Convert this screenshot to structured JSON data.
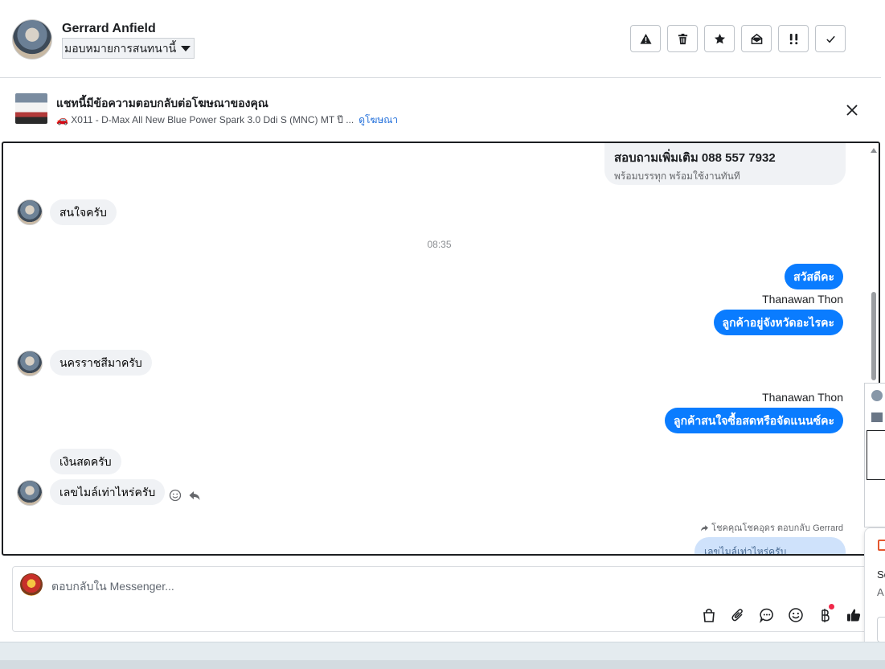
{
  "header": {
    "contact_name": "Gerrard Anfield",
    "assign_label": "มอบหมายการสนทนานี้",
    "actions": [
      {
        "name": "report-spam",
        "icon": "warning-icon"
      },
      {
        "name": "delete",
        "icon": "trash-icon"
      },
      {
        "name": "star",
        "icon": "star-icon"
      },
      {
        "name": "mark-unread",
        "icon": "envelope-open-icon"
      },
      {
        "name": "follow-up",
        "icon": "exclamation-icon"
      },
      {
        "name": "mark-done",
        "icon": "check-icon"
      }
    ]
  },
  "ad_banner": {
    "title": "แชทนี้มีข้อความตอบกลับต่อโฆษณาของคุณ",
    "subtitle": "🚗 X011 - D-Max All New Blue Power Spark 3.0 Ddi S (MNC) MT ปี ...",
    "link": "ดูโฆษณา"
  },
  "chat": {
    "ad_card": {
      "title": "สอบถามเพิ่มเติม 088 557 7932",
      "subtitle": "พร้อมบรรทุก พร้อมใช้งานทันที"
    },
    "messages": {
      "m1": "สนใจครับ",
      "time1": "08:35",
      "m2": "สวัสดีคะ",
      "sender1": "Thanawan Thon",
      "m3": "ลูกค้าอยู่จังหวัดอะไรคะ",
      "m4": "นครราชสีมาครับ",
      "sender2": "Thanawan Thon",
      "m5": "ลูกค้าสนใจซื้อสดหรือจัดแนนซ์คะ",
      "m6": "เงินสดครับ",
      "m7": "เลขไมล์เท่าไหร่ครับ",
      "reply_meta": "โชคคุณโชคอุดร ตอบกลับ Gerrard",
      "reply_quote": "เลขไมล์เท่าไหร่ครับ"
    }
  },
  "composer": {
    "placeholder": "ตอบกลับใน Messenger...",
    "tools": [
      "shopping-bag-icon",
      "paperclip-icon",
      "chat-bubble-icon",
      "emoji-icon",
      "baht-icon",
      "thumbs-up-icon"
    ]
  },
  "side_card": {
    "line1": "Sc",
    "line2": "A"
  },
  "colors": {
    "accent": "#0a7cff",
    "incoming_bubble": "#f0f2f5",
    "notification_dot": "#f02849"
  }
}
